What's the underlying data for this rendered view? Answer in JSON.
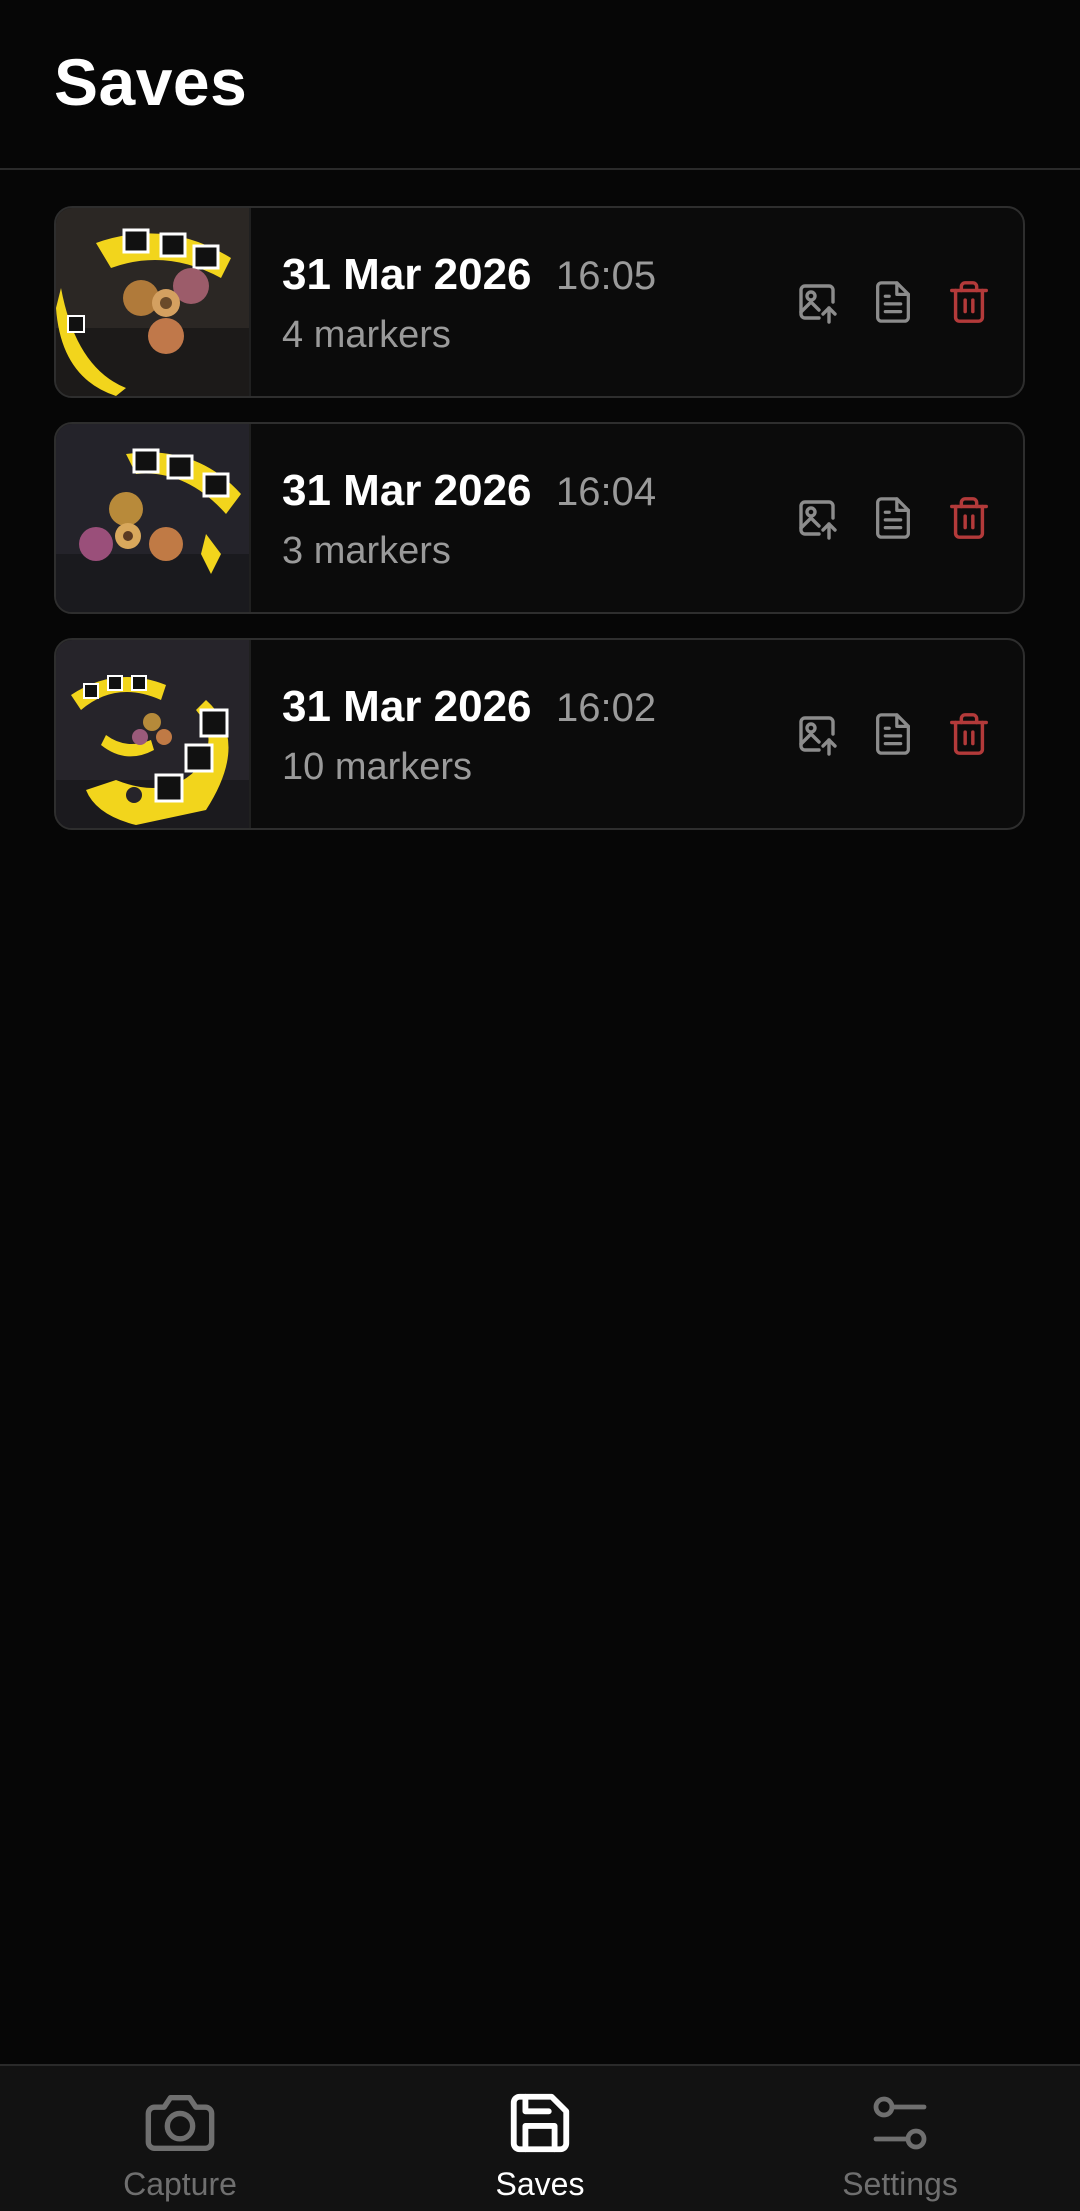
{
  "header": {
    "title": "Saves"
  },
  "colors": {
    "background": "#060606",
    "card_border": "#2e2e2e",
    "muted_text": "#9a9a9a",
    "icon_gray": "#8c8c8c",
    "delete_red": "#b33a3a",
    "nav_inactive": "#6f6f6f",
    "nav_active": "#ffffff"
  },
  "saves": [
    {
      "date": "31 Mar 2026",
      "time": "16:05",
      "markers": "4 markers"
    },
    {
      "date": "31 Mar 2026",
      "time": "16:04",
      "markers": "3 markers"
    },
    {
      "date": "31 Mar 2026",
      "time": "16:02",
      "markers": "10 markers"
    }
  ],
  "card_actions": {
    "export_image_icon": "image-upload-icon",
    "document_icon": "document-icon",
    "delete_icon": "trash-icon"
  },
  "nav": {
    "tabs": [
      {
        "label": "Capture",
        "icon": "camera-icon",
        "active": false
      },
      {
        "label": "Saves",
        "icon": "floppy-disk-icon",
        "active": true
      },
      {
        "label": "Settings",
        "icon": "sliders-icon",
        "active": false
      }
    ]
  }
}
